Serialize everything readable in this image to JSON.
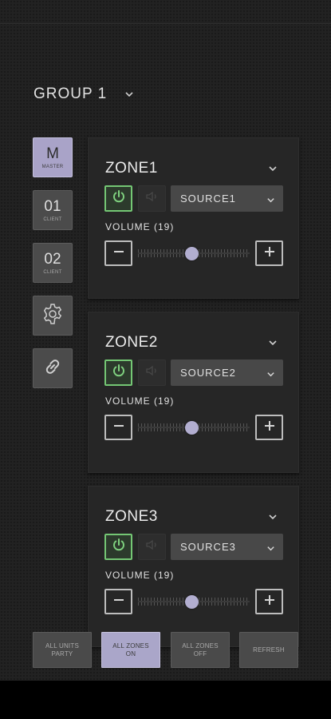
{
  "group": {
    "title": "GROUP 1",
    "chevron_icon": "chevron-down-icon"
  },
  "rail": {
    "master": {
      "big": "M",
      "small": "MASTER"
    },
    "client1": {
      "big": "01",
      "small": "CLIENT"
    },
    "client2": {
      "big": "02",
      "small": "CLIENT"
    },
    "settings_icon": "gear-icon",
    "link_icon": "link-icon"
  },
  "zones": [
    {
      "name": "ZONE1",
      "source": "SOURCE1",
      "volume_label": "VOLUME (19)",
      "volume_fraction": 0.48
    },
    {
      "name": "ZONE2",
      "source": "SOURCE2",
      "volume_label": "VOLUME (19)",
      "volume_fraction": 0.48
    },
    {
      "name": "ZONE3",
      "source": "SOURCE3",
      "volume_label": "VOLUME (19)",
      "volume_fraction": 0.48
    }
  ],
  "bottom": {
    "party": {
      "line1": "ALL UNITS",
      "line2": "PARTY"
    },
    "zones_on": {
      "line1": "ALL ZONES",
      "line2": "ON"
    },
    "zones_off": {
      "line1": "ALL ZONES",
      "line2": "OFF"
    },
    "refresh": {
      "line1": "REFRESH"
    }
  },
  "colors": {
    "accent": "#a9a3c8",
    "power_on": "#74c774",
    "background": "#222222",
    "card": "#262626"
  }
}
